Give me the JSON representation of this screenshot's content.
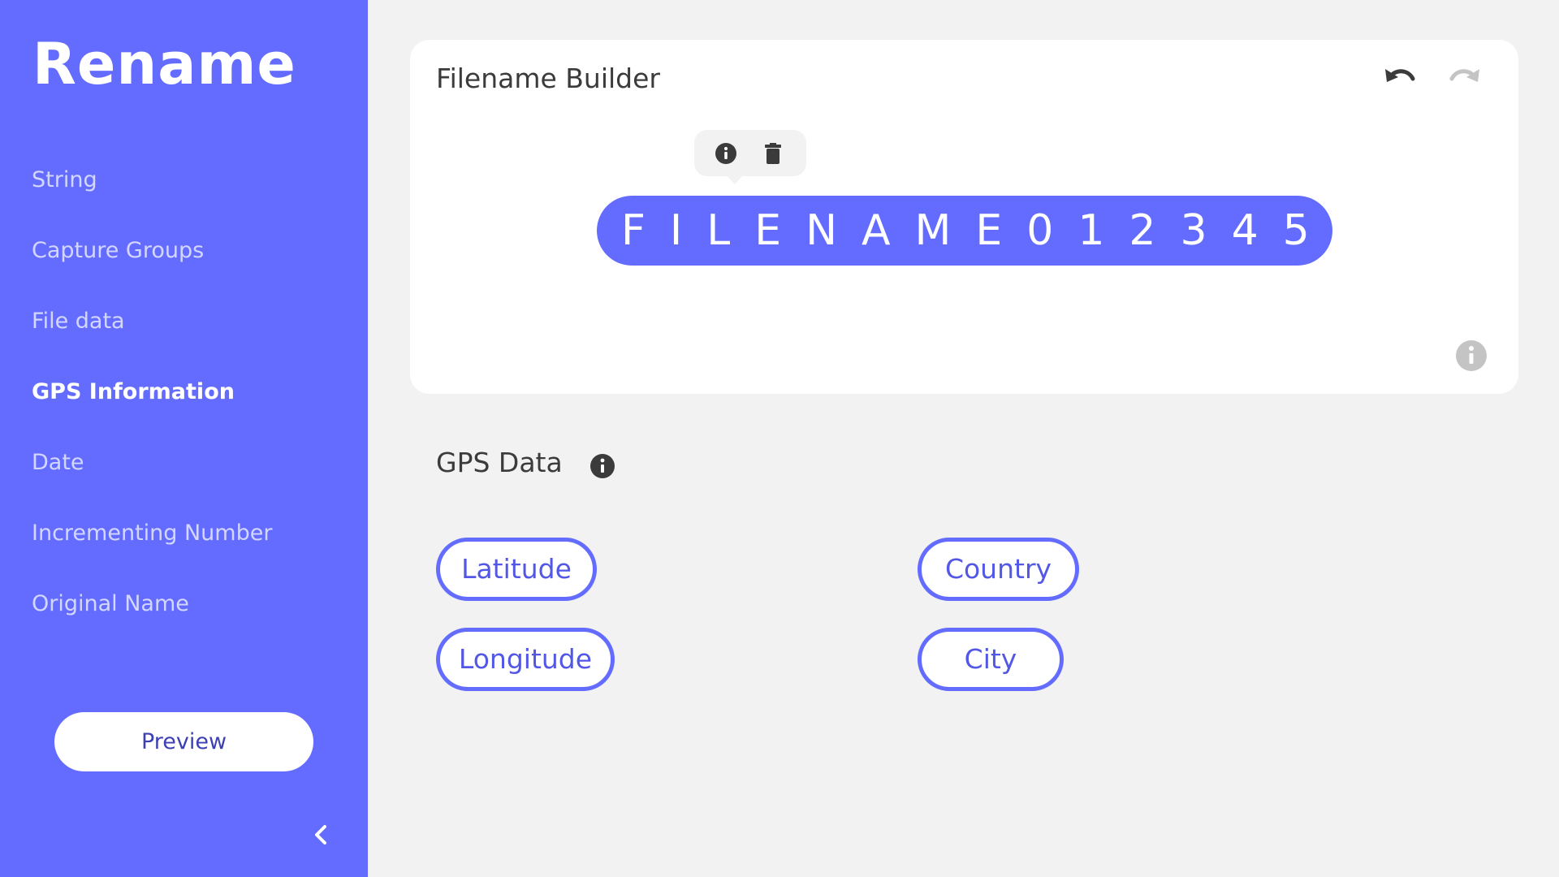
{
  "sidebar": {
    "title": "Rename",
    "items": [
      {
        "label": "String",
        "active": false
      },
      {
        "label": "Capture Groups",
        "active": false
      },
      {
        "label": "File data",
        "active": false
      },
      {
        "label": "GPS Information",
        "active": true
      },
      {
        "label": "Date",
        "active": false
      },
      {
        "label": "Incrementing Number",
        "active": false
      },
      {
        "label": "Original Name",
        "active": false
      }
    ],
    "preview_label": "Preview",
    "collapse_icon": "chevron-left-icon"
  },
  "builder": {
    "title": "Filename Builder",
    "token_text": "FILENAME012345",
    "toolbar_icons": [
      "info-icon",
      "trash-icon"
    ],
    "header_icons": [
      "undo-icon",
      "redo-icon"
    ],
    "footer_icon": "info-icon"
  },
  "gps": {
    "title": "GPS Data",
    "chips": {
      "latitude": "Latitude",
      "longitude": "Longitude",
      "country": "Country",
      "city": "City"
    }
  },
  "colors": {
    "accent": "#636cff",
    "background": "#f2f2f2",
    "card": "#ffffff",
    "text_dark": "#3b3b3b",
    "icon_disabled": "#c4c4c4"
  }
}
